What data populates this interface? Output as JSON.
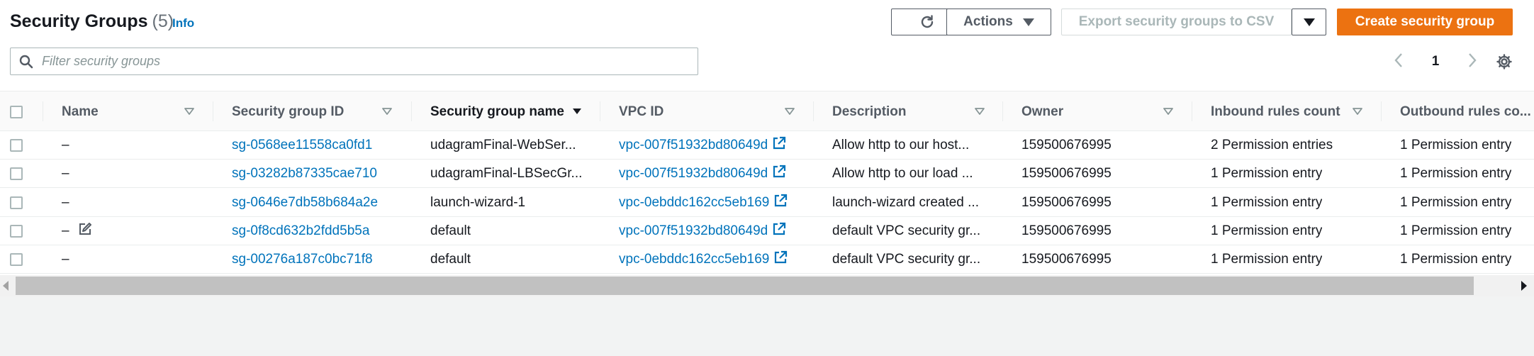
{
  "header": {
    "title": "Security Groups",
    "count": "(5)",
    "info": "Info"
  },
  "toolbar": {
    "actions_label": "Actions",
    "export_label": "Export security groups to CSV",
    "create_label": "Create security group"
  },
  "search": {
    "placeholder": "Filter security groups",
    "value": ""
  },
  "pagination": {
    "current_page": "1"
  },
  "table": {
    "columns": [
      "Name",
      "Security group ID",
      "Security group name",
      "VPC ID",
      "Description",
      "Owner",
      "Inbound rules count",
      "Outbound rules co..."
    ],
    "sorted_column": "Security group name",
    "rows": [
      {
        "name": "–",
        "sg_id": "sg-0568ee11558ca0fd1",
        "sg_name": "udagramFinal-WebSer...",
        "vpc_id": "vpc-007f51932bd80649d",
        "description": "Allow http to our host...",
        "owner": "159500676995",
        "inbound": "2 Permission entries",
        "outbound": "1 Permission entry",
        "editable_name": false
      },
      {
        "name": "–",
        "sg_id": "sg-03282b87335cae710",
        "sg_name": "udagramFinal-LBSecGr...",
        "vpc_id": "vpc-007f51932bd80649d",
        "description": "Allow http to our load ...",
        "owner": "159500676995",
        "inbound": "1 Permission entry",
        "outbound": "1 Permission entry",
        "editable_name": false
      },
      {
        "name": "–",
        "sg_id": "sg-0646e7db58b684a2e",
        "sg_name": "launch-wizard-1",
        "vpc_id": "vpc-0ebddc162cc5eb169",
        "description": "launch-wizard created ...",
        "owner": "159500676995",
        "inbound": "1 Permission entry",
        "outbound": "1 Permission entry",
        "editable_name": false
      },
      {
        "name": "–",
        "sg_id": "sg-0f8cd632b2fdd5b5a",
        "sg_name": "default",
        "vpc_id": "vpc-007f51932bd80649d",
        "description": "default VPC security gr...",
        "owner": "159500676995",
        "inbound": "1 Permission entry",
        "outbound": "1 Permission entry",
        "editable_name": true
      },
      {
        "name": "–",
        "sg_id": "sg-00276a187c0bc71f8",
        "sg_name": "default",
        "vpc_id": "vpc-0ebddc162cc5eb169",
        "description": "default VPC security gr...",
        "owner": "159500676995",
        "inbound": "1 Permission entry",
        "outbound": "1 Permission entry",
        "editable_name": false
      }
    ]
  },
  "colors": {
    "primary": "#ec7211",
    "link": "#0073bb",
    "text": "#16191f",
    "muted": "#545b64"
  },
  "icons": {
    "refresh": "refresh-icon",
    "caret": "caret-down-icon",
    "search": "search-icon",
    "settings": "gear-icon",
    "external": "external-link-icon",
    "edit": "edit-icon",
    "sort": "sort-icon"
  }
}
